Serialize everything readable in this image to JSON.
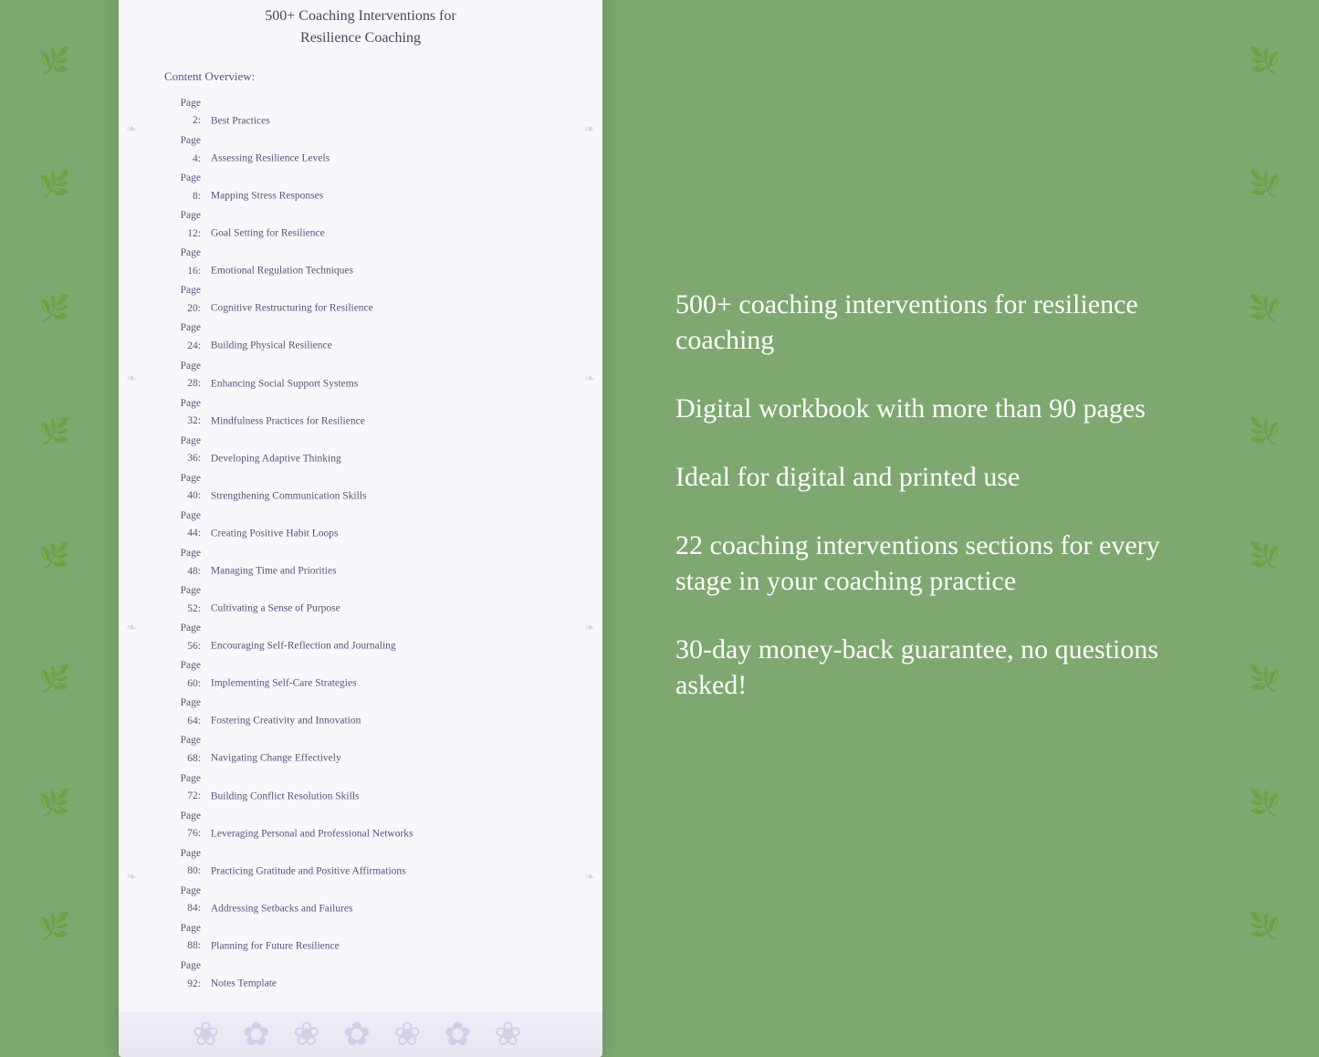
{
  "background_color": "#7fa870",
  "document": {
    "title_line1": "500+ Coaching Interventions for",
    "title_line2": "Resilience Coaching",
    "section_label": "Content Overview:",
    "toc": [
      {
        "page": "2",
        "title": "Best Practices"
      },
      {
        "page": "4",
        "title": "Assessing Resilience Levels"
      },
      {
        "page": "8",
        "title": "Mapping Stress Responses"
      },
      {
        "page": "12",
        "title": "Goal Setting for Resilience"
      },
      {
        "page": "16",
        "title": "Emotional Regulation Techniques"
      },
      {
        "page": "20",
        "title": "Cognitive Restructuring for Resilience"
      },
      {
        "page": "24",
        "title": "Building Physical Resilience"
      },
      {
        "page": "28",
        "title": "Enhancing Social Support Systems"
      },
      {
        "page": "32",
        "title": "Mindfulness Practices for Resilience"
      },
      {
        "page": "36",
        "title": "Developing Adaptive Thinking"
      },
      {
        "page": "40",
        "title": "Strengthening Communication Skills"
      },
      {
        "page": "44",
        "title": "Creating Positive Habit Loops"
      },
      {
        "page": "48",
        "title": "Managing Time and Priorities"
      },
      {
        "page": "52",
        "title": "Cultivating a Sense of Purpose"
      },
      {
        "page": "56",
        "title": "Encouraging Self-Reflection and Journaling"
      },
      {
        "page": "60",
        "title": "Implementing Self-Care Strategies"
      },
      {
        "page": "64",
        "title": "Fostering Creativity and Innovation"
      },
      {
        "page": "68",
        "title": "Navigating Change Effectively"
      },
      {
        "page": "72",
        "title": "Building Conflict Resolution Skills"
      },
      {
        "page": "76",
        "title": "Leveraging Personal and Professional Networks"
      },
      {
        "page": "80",
        "title": "Practicing Gratitude and Positive Affirmations"
      },
      {
        "page": "84",
        "title": "Addressing Setbacks and Failures"
      },
      {
        "page": "88",
        "title": "Planning for Future Resilience"
      },
      {
        "page": "92",
        "title": "Notes Template"
      }
    ]
  },
  "features": [
    "500+ coaching interventions for resilience coaching",
    "Digital workbook with more than 90 pages",
    "Ideal for digital and printed use",
    "22 coaching interventions sections for every stage in your coaching practice",
    "30-day money-back guarantee, no questions asked!"
  ],
  "mandala_char": "✿",
  "leaf_char": "🌿"
}
